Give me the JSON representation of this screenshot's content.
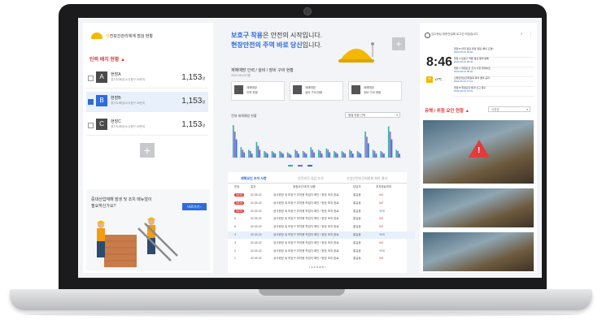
{
  "left": {
    "title_brand": "안",
    "title_rest": "전보건관리체계 점검 현황",
    "section_title": "인력 배치 현황",
    "sites": [
      {
        "letter": "A",
        "name": "현장A",
        "address": "경기도/화성시/수원구 00번지",
        "count": "1,153",
        "unit": "명",
        "selected": false
      },
      {
        "letter": "B",
        "name": "현장B",
        "address": "경기도/화성시/수원구 00번지",
        "count": "1,153",
        "unit": "명",
        "selected": true
      },
      {
        "letter": "C",
        "name": "현장C",
        "address": "경기도/화성시/수원구 00번지",
        "count": "1,153",
        "unit": "명",
        "selected": false
      }
    ],
    "add_label": "+",
    "promo_line1": "중대산업재해 발생 및 조치 매뉴얼이",
    "promo_line2": "필요하신가요?",
    "promo_button": "바로가기 ›"
  },
  "mid": {
    "headline_a": "보호구 착용",
    "headline_b": "은 안전의 시작입니다.",
    "headline_c": "현장안전의 주역 바로 당신",
    "headline_d": "입니다.",
    "plus_label": "+",
    "stats_title": "재해예방 인력 / 설비 / 장비 구비 현황",
    "stats_date": "2022.08.23기준",
    "stat_cards": [
      {
        "label": "재해예방",
        "sub": "인력 현황"
      },
      {
        "label": "재해예방",
        "sub": "설비 구비 현황"
      },
      {
        "label": "재해예방",
        "sub": "장비 구비 현황"
      }
    ],
    "chart_label": "전체 재해예방 현황",
    "chart_select": "월별 현황 선택",
    "tabs": [
      "재해요인 조치 사항",
      "안전보건 점검 조치",
      "산업안전보건위원회 회의 결과"
    ],
    "table_header": [
      "번호",
      "일자",
      "위험요인/조치 내용",
      "담당자",
      "조치완료여부"
    ],
    "rows": [
      {
        "no": "NEW",
        "date": "02.30.22",
        "desc": "공사현장 내 보호구 미착용 작업자 확인 / 현장 조치 완료",
        "owner": "홍길동",
        "status": "NO"
      },
      {
        "no": "NEW",
        "date": "02.30.22",
        "desc": "공사현장 내 보호구 미착용 작업자 확인 / 현장 조치 완료",
        "owner": "홍길동",
        "status": "NO"
      },
      {
        "no": "NEW",
        "date": "02.30.22",
        "desc": "공사현장 내 보호구 미착용 작업자 확인 / 현장 조치 완료",
        "owner": "홍길동",
        "status": "YES"
      },
      {
        "no": "6",
        "date": "02.30.22",
        "desc": "공사현장 내 보호구 미착용 작업자 확인 / 현장 조치 완료",
        "owner": "홍길동",
        "status": "NO"
      },
      {
        "no": "5",
        "date": "02.30.22",
        "desc": "공사현장 내 보호구 미착용 작업자 확인 / 현장 조치 완료",
        "owner": "홍길동",
        "status": "NO"
      },
      {
        "no": "4",
        "date": "02.30.22",
        "desc": "공사현장 내 보호구 미착용 작업자 확인 / 현장 조치 완료",
        "owner": "홍길동",
        "status": "YES"
      },
      {
        "no": "3",
        "date": "02.30.22",
        "desc": "공사현장 내 보호구 미착용 작업자 확인 / 현장 조치 완료",
        "owner": "홍길동",
        "status": "NO"
      },
      {
        "no": "2",
        "date": "02.30.22",
        "desc": "공사현장 내 보호구 미착용 작업자 확인 / 현장 조치 완료",
        "owner": "홍길동",
        "status": "YES"
      },
      {
        "no": "1",
        "date": "02.30.22",
        "desc": "공사현장 내 보호구 미착용 작업자 확인 / 현장 조치 완료",
        "owner": "홍길동",
        "status": "NO"
      }
    ],
    "pagination": "‹  1  2  3  4  5  ›"
  },
  "right": {
    "user_text": "김수현님 대한건설에 로그인 되었습니다.",
    "time": "8:46",
    "weather_temp": "13℃",
    "notifications": [
      {
        "text": "현장 B 안전 점검 일정 알림 (확인 요망)",
        "date": "2022.08.23 09:00"
      },
      {
        "text": "현장 A 보호구 착용 점검 결과 등록",
        "date": "2022.08.23 08:40"
      },
      {
        "text": "현장 C 위험요인 조치 사항 업데이트",
        "date": "2022.08.23 08:30"
      },
      {
        "text": "산업안전보건위원회 회의 결과 공지",
        "date": "2022.08.22 17:10"
      },
      {
        "text": "현장 B 위험요인 발견 신고 접수",
        "date": "2022.08.22 15:20"
      }
    ],
    "hazard_title": "유해 / 위험 요인 현황",
    "hazard_select": "시간순"
  },
  "colors": {
    "accent_blue": "#2d6cdf",
    "accent_red": "#e23b3b",
    "helmet_yellow": "#f5b800"
  },
  "chart_data": {
    "type": "bar",
    "categories": [
      "1",
      "2",
      "3",
      "4",
      "5",
      "6",
      "7",
      "8",
      "9",
      "10",
      "11",
      "12",
      "13",
      "14",
      "15",
      "16",
      "17",
      "18",
      "19",
      "20",
      "21",
      "22"
    ],
    "series": [
      {
        "values": [
          25,
          8,
          6,
          12,
          5,
          5,
          5,
          4,
          6,
          5,
          8,
          6,
          7,
          5,
          5,
          6,
          5,
          20,
          6,
          5,
          24,
          6
        ]
      },
      {
        "values": [
          20,
          6,
          5,
          9,
          4,
          4,
          4,
          3,
          5,
          4,
          6,
          5,
          6,
          4,
          4,
          5,
          4,
          16,
          5,
          4,
          20,
          5
        ]
      },
      {
        "values": [
          14,
          4,
          3,
          6,
          3,
          3,
          3,
          2,
          3,
          3,
          4,
          3,
          4,
          3,
          3,
          3,
          3,
          11,
          3,
          3,
          14,
          3
        ]
      }
    ],
    "colors": [
      "#2bb5a0",
      "#8b5ed6",
      "#2d6cdf"
    ]
  }
}
